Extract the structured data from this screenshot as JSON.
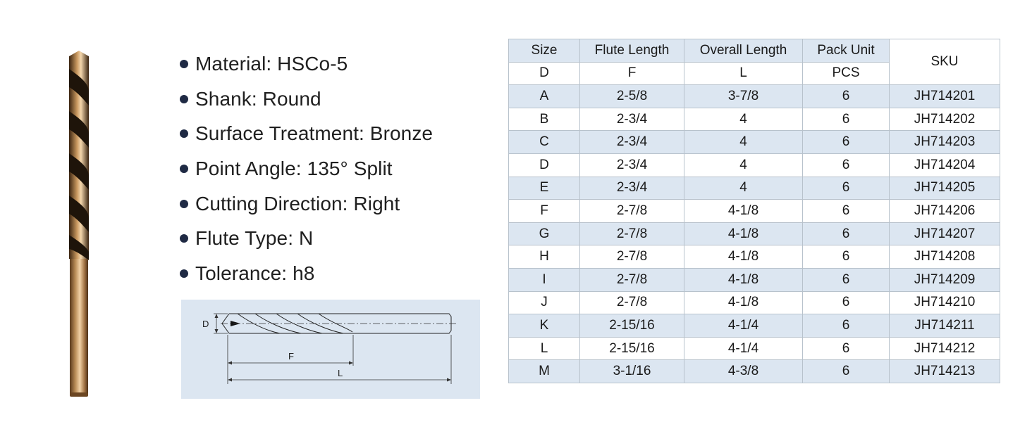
{
  "specs": [
    {
      "text": "Material: HSCo-5"
    },
    {
      "text": "Shank: Round"
    },
    {
      "text": "Surface Treatment: Bronze"
    },
    {
      "text": "Point Angle: 135° Split"
    },
    {
      "text": "Cutting Direction: Right"
    },
    {
      "text": "Flute Type: N"
    },
    {
      "text": "Tolerance: h8"
    }
  ],
  "diagram": {
    "label_d": "D",
    "label_f": "F",
    "label_l": "L"
  },
  "table": {
    "headers": {
      "size": "Size",
      "flute_length": "Flute Length",
      "overall_length": "Overall Length",
      "pack_unit": "Pack Unit",
      "sku": "SKU"
    },
    "subheaders": {
      "size": "D",
      "flute_length": "F",
      "overall_length": "L",
      "pack_unit": "PCS"
    },
    "rows": [
      {
        "size": "A",
        "flute": "2-5/8",
        "overall": "3-7/8",
        "pack": "6",
        "sku": "JH714201"
      },
      {
        "size": "B",
        "flute": "2-3/4",
        "overall": "4",
        "pack": "6",
        "sku": "JH714202"
      },
      {
        "size": "C",
        "flute": "2-3/4",
        "overall": "4",
        "pack": "6",
        "sku": "JH714203"
      },
      {
        "size": "D",
        "flute": "2-3/4",
        "overall": "4",
        "pack": "6",
        "sku": "JH714204"
      },
      {
        "size": "E",
        "flute": "2-3/4",
        "overall": "4",
        "pack": "6",
        "sku": "JH714205"
      },
      {
        "size": "F",
        "flute": "2-7/8",
        "overall": "4-1/8",
        "pack": "6",
        "sku": "JH714206"
      },
      {
        "size": "G",
        "flute": "2-7/8",
        "overall": "4-1/8",
        "pack": "6",
        "sku": "JH714207"
      },
      {
        "size": "H",
        "flute": "2-7/8",
        "overall": "4-1/8",
        "pack": "6",
        "sku": "JH714208"
      },
      {
        "size": "I",
        "flute": "2-7/8",
        "overall": "4-1/8",
        "pack": "6",
        "sku": "JH714209"
      },
      {
        "size": "J",
        "flute": "2-7/8",
        "overall": "4-1/8",
        "pack": "6",
        "sku": "JH714210"
      },
      {
        "size": "K",
        "flute": "2-15/16",
        "overall": "4-1/4",
        "pack": "6",
        "sku": "JH714211"
      },
      {
        "size": "L",
        "flute": "2-15/16",
        "overall": "4-1/4",
        "pack": "6",
        "sku": "JH714212"
      },
      {
        "size": "M",
        "flute": "3-1/16",
        "overall": "4-3/8",
        "pack": "6",
        "sku": "JH714213"
      }
    ]
  },
  "colors": {
    "row_alt": "#dce6f1",
    "bullet": "#1f2a44",
    "bronze": "#a97a45"
  }
}
